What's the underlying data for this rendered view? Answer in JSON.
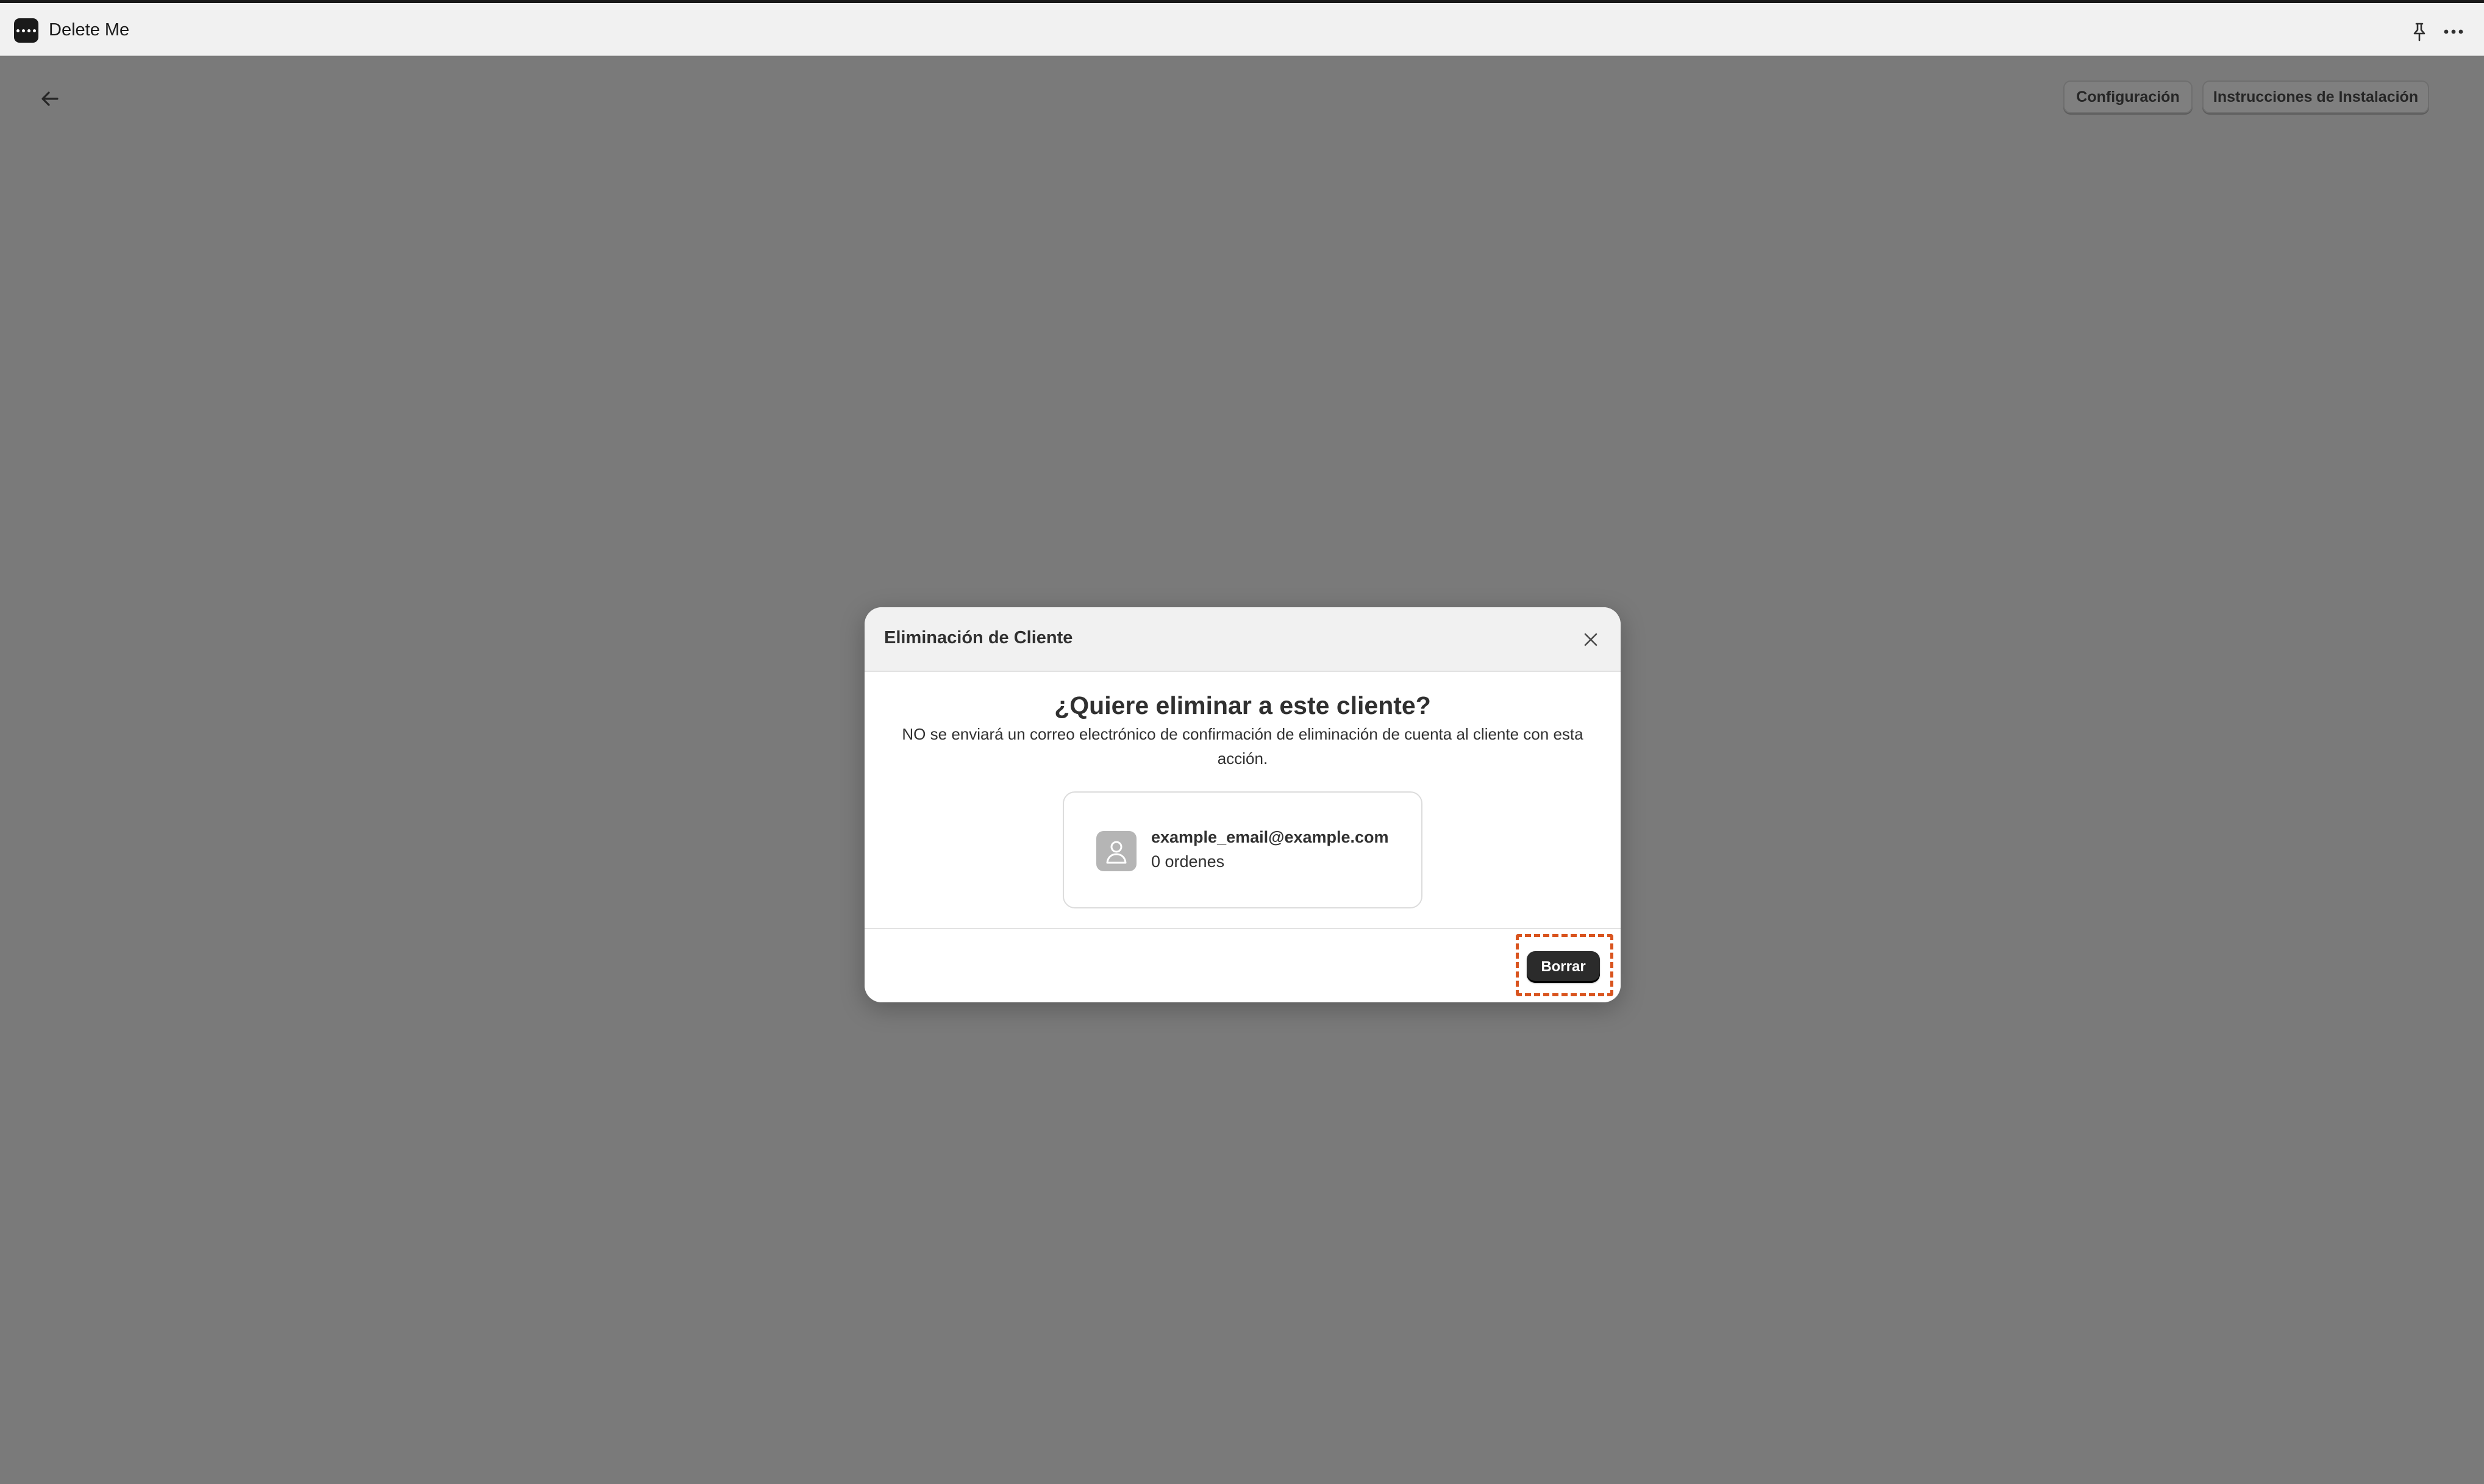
{
  "app": {
    "title": "Delete Me",
    "icons": {
      "app": "app-dots-icon",
      "pin": "pin-icon",
      "more": "more-horizontal-icon"
    }
  },
  "page": {
    "back_icon": "arrow-left-icon",
    "buttons": {
      "config_label": "Configuración",
      "install_label": "Instrucciones de Instalación"
    }
  },
  "modal": {
    "title": "Eliminación de Cliente",
    "close_icon": "close-icon",
    "question": "¿Quiere eliminar a este cliente?",
    "notice": "NO se enviará un correo electrónico de confirmación de eliminación de cuenta al cliente con esta acción.",
    "customer": {
      "avatar_icon": "user-icon",
      "email": "example_email@example.com",
      "orders": "0 ordenes"
    },
    "delete_label": "Borrar"
  },
  "colors": {
    "overlay": "#7a7a7a",
    "primary_button": "#2b2b2b",
    "highlight": "#d9541e"
  }
}
